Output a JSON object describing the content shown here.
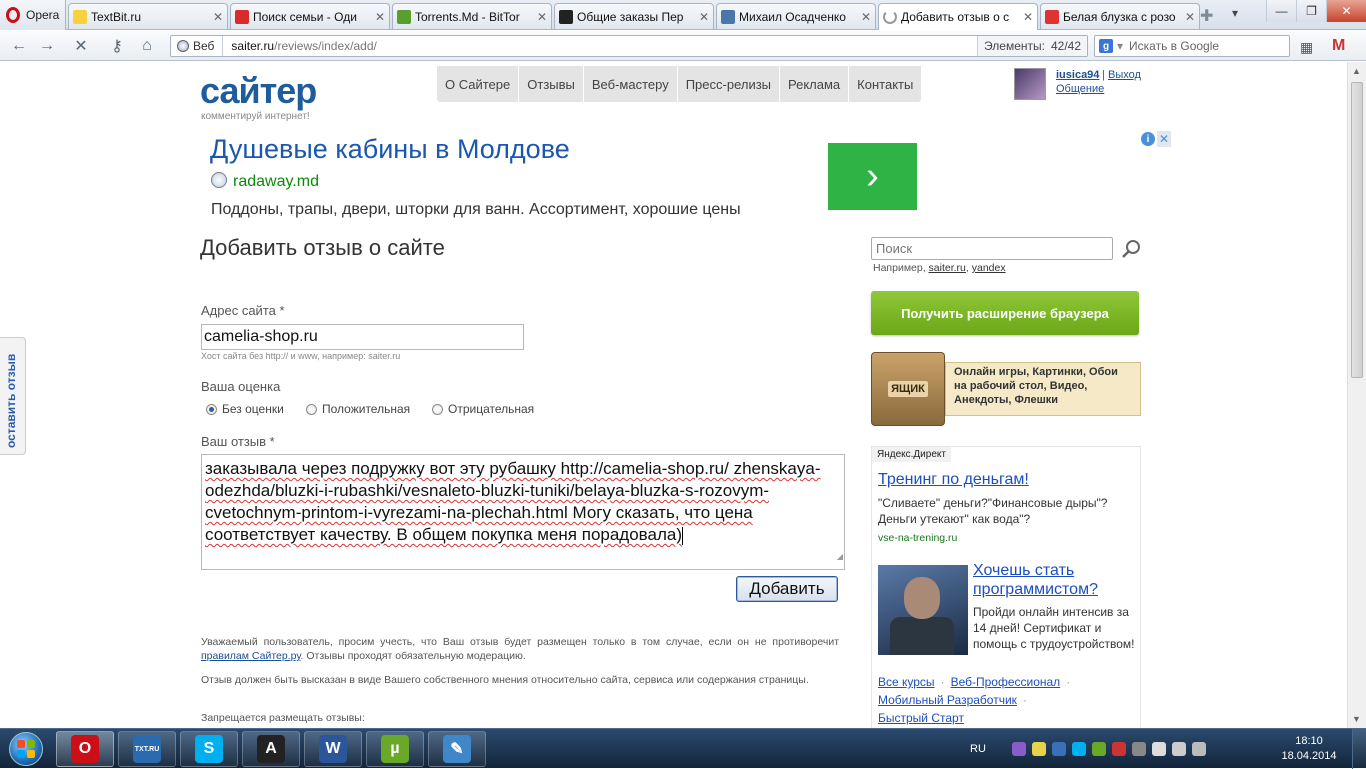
{
  "browser": {
    "menu_label": "Opera",
    "tabs": [
      {
        "title": "TextBit.ru",
        "icon": "textbit-favicon",
        "color": "#f7d23e"
      },
      {
        "title": "Поиск семьи - Оди",
        "icon": "youtube-favicon",
        "color": "#d92b2b"
      },
      {
        "title": "Torrents.Md - BitTor",
        "icon": "torrentsmd-favicon",
        "color": "#5a9e2c"
      },
      {
        "title": "Общие заказы Пер",
        "icon": "advego-favicon",
        "color": "#222222"
      },
      {
        "title": "Михаил Осадченко",
        "icon": "vk-favicon",
        "color": "#4a76a8"
      },
      {
        "title": "Добавить отзыв о с",
        "icon": "loading-icon",
        "color": "#999999"
      },
      {
        "title": "Белая блузка с розо",
        "icon": "camelia-favicon",
        "color": "#d33"
      }
    ],
    "active_tab": 5,
    "address": {
      "mode_label": "Веб",
      "host": "saiter.ru",
      "path": "/reviews/index/add/",
      "elements_label": "Элементы:",
      "elements_value": "42/42"
    },
    "search_placeholder": "Искать в Google"
  },
  "site": {
    "logo": "сайтер",
    "tagline": "комментируй интернет!",
    "nav": [
      "О Сайтере",
      "Отзывы",
      "Веб-мастеру",
      "Пресс-релизы",
      "Реклама",
      "Контакты"
    ],
    "user": {
      "name": "iusica94",
      "sep": "|",
      "logout": "Выход",
      "chat": "Общение"
    }
  },
  "ad": {
    "title": "Душевые кабины в Молдове",
    "url": "radaway.md",
    "description": "Поддоны, трапы, двери, шторки для ванн. Ассортимент, хорошие цены",
    "go_symbol": "›",
    "info_symbol": "i",
    "close_symbol": "✕"
  },
  "form": {
    "page_title": "Добавить отзыв о сайте",
    "site_label": "Адрес сайта *",
    "site_value": "camelia-shop.ru",
    "site_hint": "Хост сайта без http:// и www, например: saiter.ru",
    "rating_label": "Ваша оценка",
    "rating_options": [
      "Без оценки",
      "Положительная",
      "Отрицательная"
    ],
    "rating_selected": 0,
    "review_label": "Ваш отзыв *",
    "review_text": "заказывала через подружку вот эту рубашку http://camelia-shop.ru/ zhenskaya-odezhda/bluzki-i-rubashki/vesnaleto-bluzki-tuniki/belaya-bluzka-s-rozovym-cvetochnym-printom-i-vyrezami-na-plechah.html  Могу сказать, что цена соответствует качеству. В общем  покупка меня порадовала)",
    "submit_label": "Добавить",
    "notice1_a": "Уважаемый пользователь, просим учесть, что Ваш отзыв будет размещен только в том случае, если он не противоречит ",
    "notice1_link": "правилам Сайтер.ру",
    "notice1_b": ". Отзывы проходят обязательную модерацию.",
    "notice2": "Отзыв должен быть высказан в виде Вашего собственного мнения относительно сайта, сервиса или содержания страницы.",
    "notice3": "Запрещается размещать отзывы:"
  },
  "sidebar": {
    "search_placeholder": "Поиск",
    "example_prefix": "Например, ",
    "example_1": "saiter.ru",
    "example_sep": ", ",
    "example_2": "yandex",
    "extension_button": "Получить расширение браузера",
    "box_label": "ЯЩИК",
    "box_text": "Онлайн игры, Картинки, Обои на рабочий стол, Видео, Анекдоты, Флешки",
    "direct": {
      "header": "Яндекс.Директ",
      "ad1_title": "Тренинг по деньгам!",
      "ad1_text": "\"Сливаете\" деньги?\"Финансовые дыры\"? Деньги утекают\" как вода\"?",
      "ad1_url": "vse-na-trening.ru",
      "ad2_title": "Хочешь стать программистом?",
      "ad2_text": "Пройди онлайн интенсив за 14 дней! Сертификат и помощь с трудоустройством!",
      "ad2_links": [
        "Все курсы",
        "Веб-Профессионал",
        "Мобильный Разработчик",
        "Быстрый Старт"
      ]
    }
  },
  "side_tab": "оставить отзыв",
  "taskbar": {
    "apps": [
      {
        "name": "opera-taskbar-icon",
        "label": "O",
        "color": "#cc0f16",
        "active": true
      },
      {
        "name": "txtru-taskbar-icon",
        "label": "TXT.RU",
        "color": "#2a6bb0",
        "active": false
      },
      {
        "name": "skype-taskbar-icon",
        "label": "S",
        "color": "#00aff0",
        "active": false
      },
      {
        "name": "advego-taskbar-icon",
        "label": "A",
        "color": "#222222",
        "active": false
      },
      {
        "name": "word-taskbar-icon",
        "label": "W",
        "color": "#2b579a",
        "active": false
      },
      {
        "name": "utorrent-taskbar-icon",
        "label": "µ",
        "color": "#6aa82a",
        "active": false
      },
      {
        "name": "paint-taskbar-icon",
        "label": "✎",
        "color": "#3f87c9",
        "active": false
      }
    ],
    "language": "RU",
    "time": "18:10",
    "date": "18.04.2014"
  }
}
